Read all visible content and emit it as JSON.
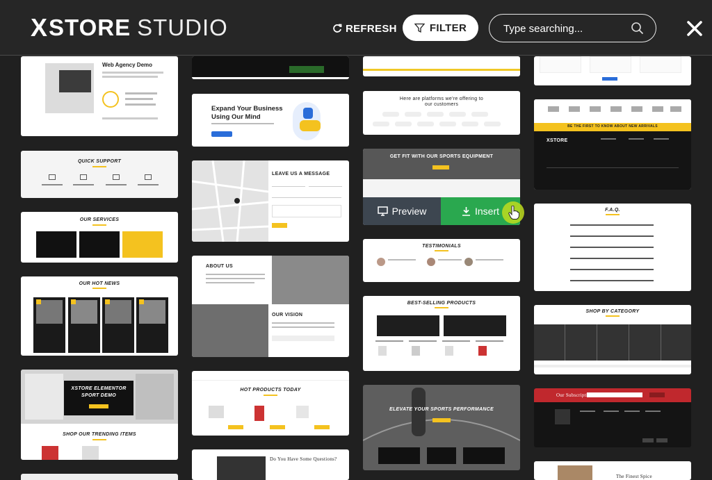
{
  "header": {
    "logo_x": "X",
    "logo_store": "STORE",
    "logo_studio": "STUDIO",
    "refresh_label": "REFRESH",
    "filter_label": "FILTER",
    "search_placeholder": "Type searching...",
    "icons": {
      "refresh": "refresh-icon",
      "filter": "filter-icon",
      "search": "search-icon",
      "close": "close-icon"
    }
  },
  "overlay": {
    "preview_label": "Preview",
    "insert_label": "Insert"
  },
  "cards": {
    "c1_title_a": "Web Agency Demo",
    "c2_title": "QUICK SUPPORT",
    "c3_title": "OUR SERVICES",
    "c4_title": "OUR HOT NEWS",
    "c5_title_a": "XSTORE ELEMENTOR",
    "c5_title_b": "SPORT DEMO",
    "c5_sub": "SHOP OUR TRENDING ITEMS",
    "c7_title_a": "Expand Your Business",
    "c7_title_b": "Using Our Mind",
    "c8_title": "LEAVE US A MESSAGE",
    "c9_title": "ABOUT US",
    "c9_sub": "OUR VISION",
    "c10_title": "HOT PRODUCTS TODAY",
    "c11_title": "Do You Have Some Questions?",
    "c12_title_a": "Here are platforms we're offering to",
    "c12_title_b": "our customers",
    "c13_title": "GET FIT WITH OUR SPORTS EQUIPMENT",
    "c14_title": "TESTIMONIALS",
    "c15_title": "BEST-SELLING PRODUCTS",
    "c16_title": "ELEVATE YOUR SPORTS PERFORMANCE",
    "c18_logo": "XSTORE",
    "c18_banner": "BE THE FIRST TO KNOW ABOUT NEW ARRIVALS",
    "c19_title": "F.A.Q.",
    "c20_title": "SHOP BY CATEGORY",
    "c21_title": "Our Subscription",
    "c22_title": "The Finest Spice"
  },
  "colors": {
    "accent_green": "#2aa84f",
    "preview_bg": "#3d4650",
    "yellow": "#f4c21f",
    "red": "#c0282d"
  }
}
